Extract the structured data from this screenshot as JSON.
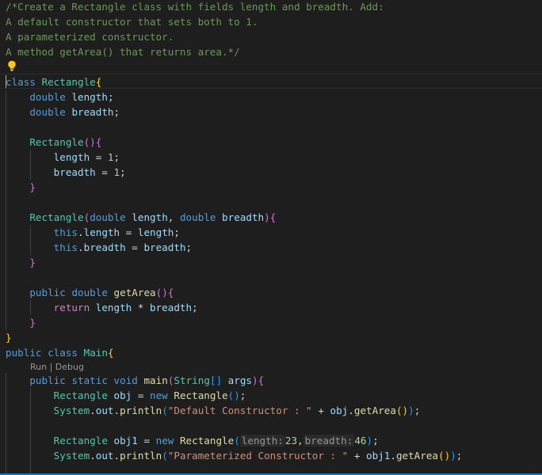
{
  "editor": {
    "comment": [
      "/*Create a Rectangle class with fields length and breadth. Add:",
      "A default constructor that sets both to 1.",
      "A parameterized constructor.",
      "A method getArea() that returns area.*/"
    ],
    "codelens": {
      "run": "Run",
      "separator": " | ",
      "debug": "Debug"
    },
    "hints": {
      "length": "length:",
      "breadth": "breadth:"
    },
    "strings": {
      "default": "\"Default Constructor : \"",
      "parameterized": "\"Parameterized Constructor : \""
    },
    "numbers": {
      "one": "1",
      "len": "23",
      "bre": "46"
    },
    "icons": {
      "lightbulb": "lightbulb-icon"
    },
    "colors": {
      "background": "#1e1e1e",
      "comment": "#6a9955",
      "keyword": "#569cd6",
      "control": "#c586c0",
      "type": "#4ec9b0",
      "variable": "#9cdcfe",
      "function": "#dcdcaa",
      "string": "#ce9178",
      "number": "#b5cea8",
      "accent": "#007acc"
    }
  }
}
